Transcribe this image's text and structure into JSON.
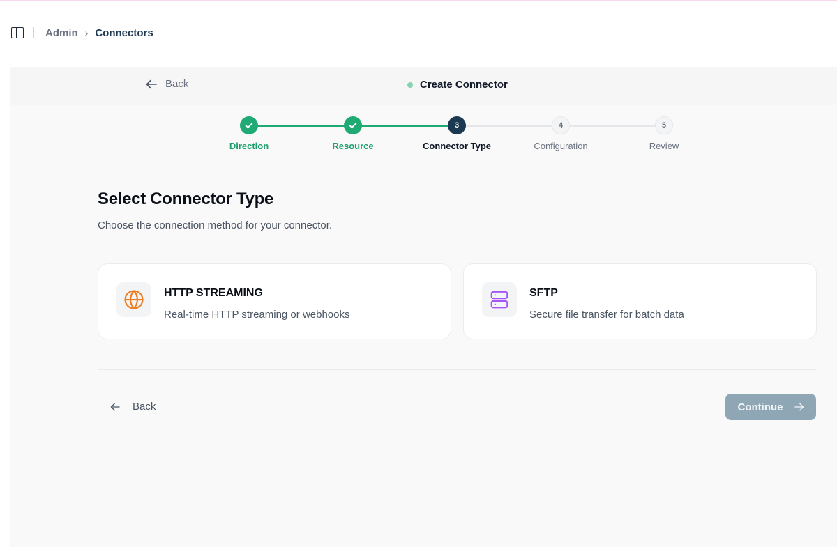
{
  "breadcrumb": {
    "parent": "Admin",
    "separator": "›",
    "current": "Connectors"
  },
  "header": {
    "back_label": "Back",
    "title": "Create Connector"
  },
  "steps": [
    {
      "number": "1",
      "label": "Direction",
      "state": "done"
    },
    {
      "number": "2",
      "label": "Resource",
      "state": "done"
    },
    {
      "number": "3",
      "label": "Connector Type",
      "state": "current"
    },
    {
      "number": "4",
      "label": "Configuration",
      "state": "pending"
    },
    {
      "number": "5",
      "label": "Review",
      "state": "pending"
    }
  ],
  "main": {
    "title": "Select Connector Type",
    "subtitle": "Choose the connection method for your connector."
  },
  "cards": [
    {
      "icon": "globe-icon",
      "title": "HTTP STREAMING",
      "description": "Real-time HTTP streaming or webhooks",
      "icon_color": "#f07b1d"
    },
    {
      "icon": "server-icon",
      "title": "SFTP",
      "description": "Secure file transfer for batch data",
      "icon_color": "#a855f7"
    }
  ],
  "footer": {
    "back_label": "Back",
    "continue_label": "Continue"
  },
  "colors": {
    "accent_done": "#1faa74",
    "accent_current": "#1b3a52",
    "continue_disabled": "#8fa7b5"
  }
}
